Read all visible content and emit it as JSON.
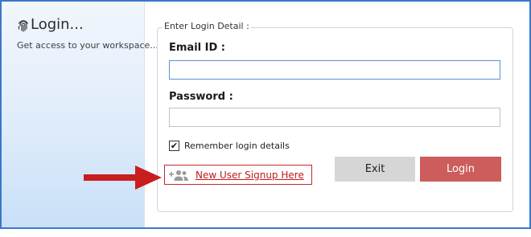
{
  "sidebar": {
    "title": "Login...",
    "subtitle": "Get access to your workspace..."
  },
  "form": {
    "group_title": "Enter Login Detail :",
    "email_label": "Email ID :",
    "email_value": "",
    "password_label": "Password :",
    "password_value": "",
    "remember_label": "Remember login details",
    "remember_checked": true,
    "exit_label": "Exit",
    "login_label": "Login",
    "signup_link": "New User Signup Here"
  },
  "icons": {
    "title": "fingerprint-icon",
    "signup": "add-user-icon",
    "annotation": "red-arrow"
  },
  "colors": {
    "login_button": "#cd5c5c",
    "exit_button": "#d6d6d6",
    "signup_text": "#c01919",
    "arrow": "#c81e1e",
    "window_border": "#3a78c8"
  }
}
